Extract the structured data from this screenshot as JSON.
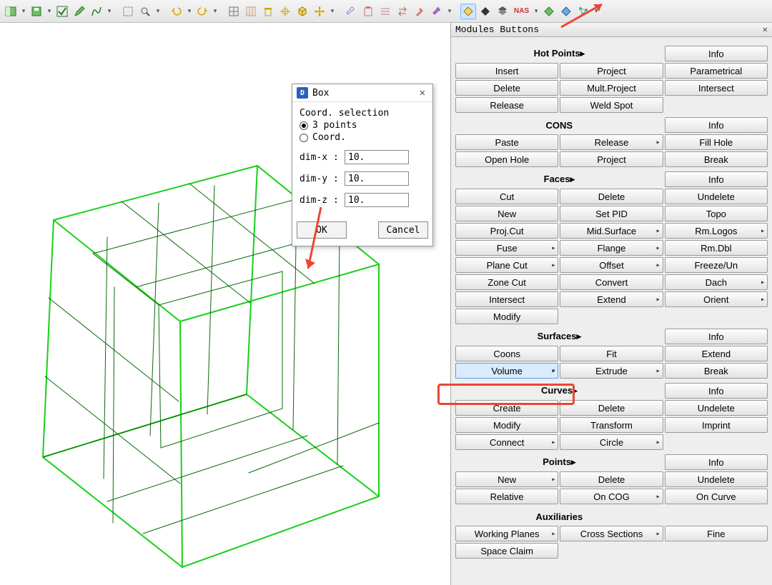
{
  "toolbar": {
    "icons": [
      "panel-icon",
      "chevron-icon",
      "save-icon",
      "chevron-icon",
      "check-icon",
      "pencil-icon",
      "curve-icon",
      "chevron-icon",
      "select-box-icon",
      "zoom-icon",
      "chevron-icon",
      "undo-icon",
      "chevron-icon",
      "redo-icon",
      "chevron-icon",
      "grid-icon",
      "grid2-icon",
      "trash-icon",
      "target-icon",
      "cube-icon",
      "move-icon",
      "chevron-icon",
      "wrench-icon",
      "clipboard-icon",
      "align-icon",
      "swap-icon",
      "hammer-icon",
      "wrench2-icon",
      "chevron-icon",
      "diamond-yellow-icon",
      "diamond-black-icon",
      "diamond-stack-icon",
      "nas-label",
      "chevron-icon",
      "diamond-green-icon",
      "diamond-blue-icon",
      "graph-icon",
      "chevron-icon"
    ],
    "nas_label": "NAS"
  },
  "dialog": {
    "title": "Box",
    "section_label": "Coord. selection",
    "opt_3points": "3 points",
    "opt_coord": "Coord.",
    "dimx_label": "dim-x :",
    "dimy_label": "dim-y :",
    "dimz_label": "dim-z :",
    "dimx": "10.",
    "dimy": "10.",
    "dimz": "10.",
    "ok": "OK",
    "cancel": "Cancel"
  },
  "panel": {
    "title": "Modules Buttons",
    "info": "Info",
    "hotpoints": {
      "header": "Hot Points▸",
      "rows": [
        [
          "Insert",
          "Project",
          "Parametrical"
        ],
        [
          "Delete",
          "Mult.Project",
          "Intersect"
        ],
        [
          "Release",
          "Weld Spot",
          ""
        ]
      ]
    },
    "cons": {
      "header": "CONS",
      "rows": [
        [
          "Paste",
          "Release",
          "Fill Hole"
        ],
        [
          "Open Hole",
          "Project",
          "Break"
        ]
      ],
      "split": [
        false,
        true,
        false,
        false,
        false,
        false
      ]
    },
    "faces": {
      "header": "Faces▸",
      "rows": [
        [
          "Cut",
          "Delete",
          "Undelete"
        ],
        [
          "New",
          "Set PID",
          "Topo"
        ],
        [
          "Proj.Cut",
          "Mid.Surface",
          "Rm.Logos"
        ],
        [
          "Fuse",
          "Flange",
          "Rm.Dbl"
        ],
        [
          "Plane Cut",
          "Offset",
          "Freeze/Un"
        ],
        [
          "Zone Cut",
          "Convert",
          "Dach"
        ],
        [
          "Intersect",
          "Extend",
          "Orient"
        ],
        [
          "Modify",
          "",
          ""
        ]
      ],
      "split": [
        [
          false,
          false,
          false
        ],
        [
          false,
          false,
          false
        ],
        [
          false,
          true,
          true
        ],
        [
          true,
          true,
          false
        ],
        [
          true,
          true,
          false
        ],
        [
          false,
          false,
          true
        ],
        [
          false,
          true,
          true
        ],
        [
          false,
          false,
          false
        ]
      ]
    },
    "surfaces": {
      "header": "Surfaces▸",
      "rows": [
        [
          "Coons",
          "Fit",
          "Extend"
        ],
        [
          "Volume",
          "Extrude",
          "Break"
        ]
      ],
      "split": [
        [
          false,
          false,
          false
        ],
        [
          true,
          true,
          false
        ]
      ]
    },
    "curves": {
      "header": "Curves▸",
      "rows": [
        [
          "Create",
          "Delete",
          "Undelete"
        ],
        [
          "Modify",
          "Transform",
          "Imprint"
        ],
        [
          "Connect",
          "Circle",
          ""
        ]
      ],
      "split": [
        [
          false,
          false,
          false
        ],
        [
          false,
          false,
          false
        ],
        [
          true,
          true,
          false
        ]
      ]
    },
    "points": {
      "header": "Points▸",
      "rows": [
        [
          "New",
          "Delete",
          "Undelete"
        ],
        [
          "Relative",
          "On COG",
          "On Curve"
        ]
      ],
      "split": [
        [
          true,
          false,
          false
        ],
        [
          false,
          true,
          false
        ]
      ]
    },
    "aux": {
      "header": "Auxiliaries",
      "rows": [
        [
          "Working Planes",
          "Cross Sections",
          "Fine"
        ],
        [
          "Space Claim",
          "",
          ""
        ]
      ],
      "split": [
        [
          true,
          true,
          false
        ],
        [
          false,
          false,
          false
        ]
      ]
    }
  }
}
